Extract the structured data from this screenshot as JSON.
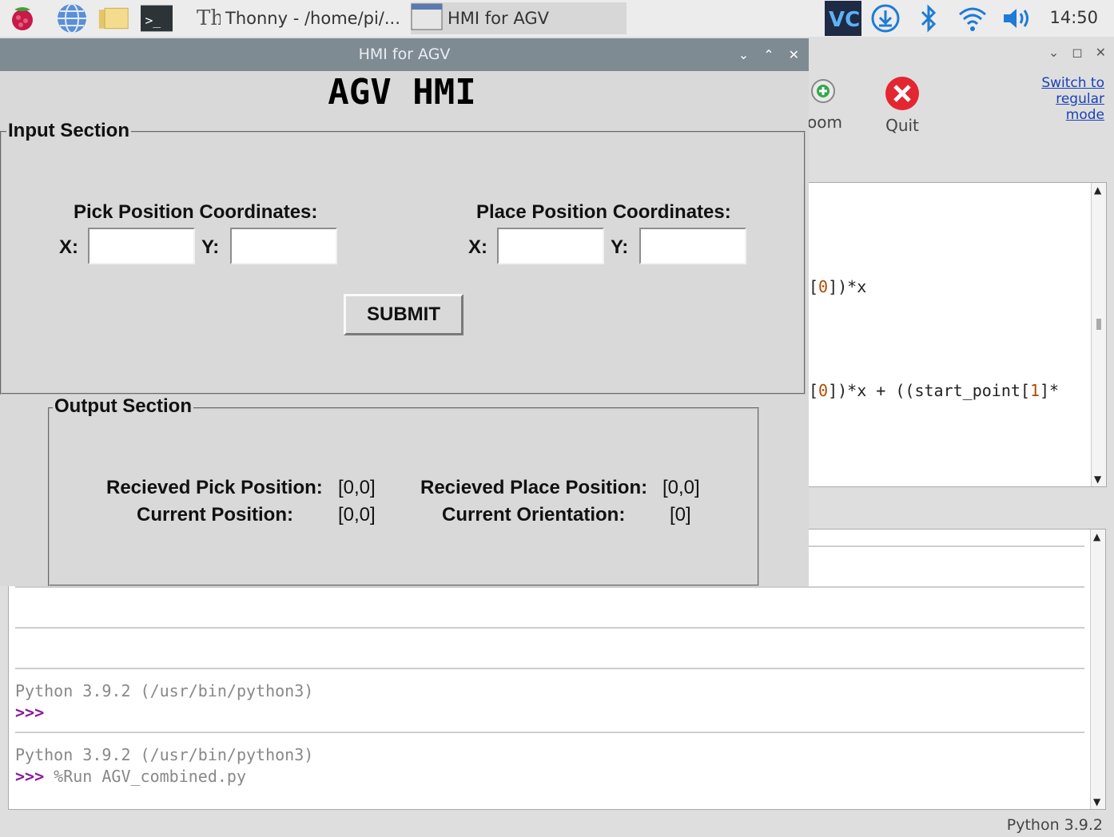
{
  "taskbar": {
    "tasks": [
      {
        "label": "Thonny  -  /home/pi/..."
      },
      {
        "label": "HMI for AGV"
      }
    ],
    "clock": "14:50"
  },
  "thonny": {
    "switch_mode_lines": [
      "Switch to",
      "regular",
      "mode"
    ],
    "toolbar": {
      "zoom_label": "oom",
      "quit_label": "Quit"
    },
    "editor_lines": [
      {
        "pre": "[",
        "num": "0",
        "post": "])*x"
      },
      {
        "pre": "[",
        "num": "0",
        "post": "])*x + ((start_point[",
        "num2": "1",
        "post2": "]*"
      }
    ],
    "shell": {
      "line1": "Python 3.9.2 (/usr/bin/python3)",
      "prompt1": ">>>",
      "line2": "Python 3.9.2 (/usr/bin/python3)",
      "prompt2": ">>>",
      "command": "%Run AGV_combined.py"
    },
    "status": "Python 3.9.2"
  },
  "hmi": {
    "window_title": "HMI for AGV",
    "heading": "AGV HMI",
    "input_section": {
      "title": "Input Section",
      "pick_title": "Pick Position Coordinates:",
      "place_title": "Place Position Coordinates:",
      "x_label": "X:",
      "y_label": "Y:",
      "pick_x": "",
      "pick_y": "",
      "place_x": "",
      "place_y": "",
      "submit_label": "SUBMIT"
    },
    "output_section": {
      "title": "Output Section",
      "recv_pick_label": "Recieved Pick Position:",
      "recv_pick_value": "[0,0]",
      "recv_place_label": "Recieved Place Position:",
      "recv_place_value": "[0,0]",
      "current_pos_label": "Current Position:",
      "current_pos_value": "[0,0]",
      "current_orient_label": "Current Orientation:",
      "current_orient_value": "[0]"
    }
  },
  "icons": {
    "menu": "raspberry-icon",
    "browser": "globe-icon",
    "files": "folder-icon",
    "terminal": "terminal-icon",
    "vscode": "vscode-icon",
    "updater": "download-icon",
    "bluetooth": "bluetooth-icon",
    "wifi": "wifi-icon",
    "volume": "volume-icon"
  },
  "colors": {
    "quit_red": "#e32630",
    "link_blue": "#1a40b8",
    "prompt_purple": "#8b1a9b",
    "titlebar": "#7f8b93"
  }
}
